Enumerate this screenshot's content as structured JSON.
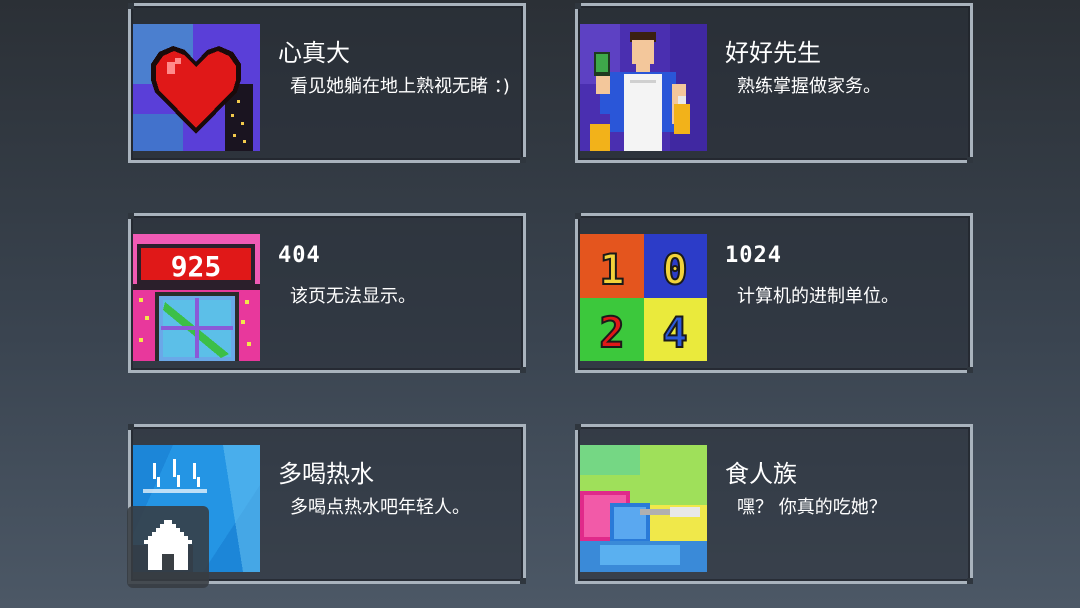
{
  "achievements": [
    {
      "title": "心真大",
      "desc": "看见她躺在地上熟视无睹 ：)",
      "icon": "pixel-heart-icon"
    },
    {
      "title": "好好先生",
      "desc": "熟练掌握做家务。",
      "icon": "pixel-housekeeper-icon"
    },
    {
      "title": "404",
      "desc": "该页无法显示。",
      "icon": "pixel-925-shop-icon",
      "badge_text": "925"
    },
    {
      "title": "1024",
      "desc": "计算机的进制单位。",
      "icon": "pixel-1024-tiles-icon",
      "digits": [
        "1",
        "0",
        "2",
        "4"
      ]
    },
    {
      "title": "多喝热水",
      "desc": "多喝点热水吧年轻人。",
      "icon": "pixel-hot-water-icon"
    },
    {
      "title": "食人族",
      "desc": "嘿？ 你真的吃她？",
      "icon": "pixel-cannibal-icon"
    }
  ],
  "home_button": {
    "icon": "home-icon"
  },
  "colors": {
    "card_border": "#a9b3bd",
    "text": "#ffffff",
    "background_top": "#2b3036",
    "background_bottom": "#4c5866"
  }
}
